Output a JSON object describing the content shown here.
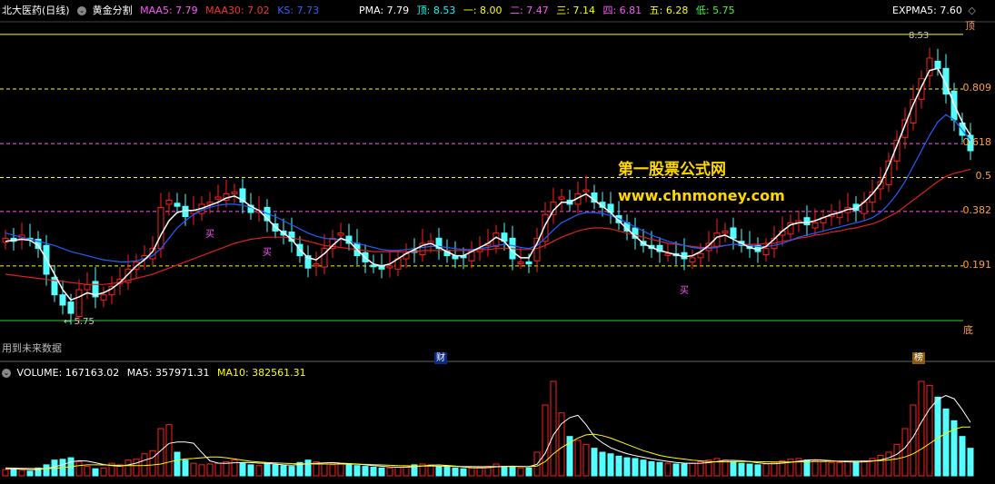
{
  "header": {
    "title": "北大医药(日线)",
    "formula": "黄金分割",
    "maa5_label": "MAA5: 7.79",
    "maa30_label": "MAA30: 7.02",
    "ks_label": "KS: 7.73",
    "pma_label": "PMA: 7.79",
    "top_label": "顶: 8.53",
    "l1_label": "一: 8.00",
    "l2_label": "二: 7.47",
    "l3_label": "三: 7.14",
    "l4_label": "四: 6.81",
    "l5_label": "五: 6.28",
    "low_label": "低: 5.75",
    "expma_label": "EXPMA5: 7.60"
  },
  "volume_header": {
    "volume_label": "VOLUME: 167163.02",
    "ma5_label": "MA5: 357971.31",
    "ma10_label": "MA10: 382561.31"
  },
  "watermark": {
    "line1": "第一股票公式网",
    "line2": "www.chnmoney.com"
  },
  "notes": {
    "future_data": "用到未来数据",
    "top_tag": "顶",
    "bottom_tag": "底",
    "finance_tag": "财",
    "rank_tag": "榜"
  },
  "chart_data": [
    {
      "type": "candlestick",
      "title": "北大医药(日线)",
      "ylim": [
        5.6,
        8.6
      ],
      "high_marker": "8.53",
      "low_marker": "5.75",
      "levels": [
        {
          "price": 8.53,
          "label": "顶",
          "color": "#ffff00"
        },
        {
          "price": 8.0,
          "label": "0.809",
          "color": "#ffff00"
        },
        {
          "price": 7.47,
          "label": "0.618",
          "color": "#ff55ff"
        },
        {
          "price": 7.14,
          "label": "0.5",
          "color": "#ffff00"
        },
        {
          "price": 6.81,
          "label": "0.382",
          "color": "#ff55ff"
        },
        {
          "price": 6.28,
          "label": "0.191",
          "color": "#ffff00"
        },
        {
          "price": 5.75,
          "label": "底",
          "color": "#33cc33"
        }
      ],
      "buy_signals": [
        {
          "index": 25,
          "label": "买"
        },
        {
          "index": 32,
          "label": "买"
        },
        {
          "index": 83,
          "label": "买"
        }
      ],
      "colors": {
        "up": "#ff2020",
        "down": "#54ffff",
        "ma_white": "#ffffff",
        "ma_blue": "#2060ff",
        "ma_red": "#e02020"
      },
      "close": [
        6.55,
        6.52,
        6.58,
        6.54,
        6.45,
        6.2,
        6.0,
        5.9,
        5.82,
        6.05,
        6.1,
        5.98,
        6.0,
        6.08,
        6.15,
        6.25,
        6.32,
        6.38,
        6.45,
        6.85,
        6.92,
        6.86,
        6.76,
        6.82,
        6.88,
        6.9,
        6.95,
        6.98,
        7.0,
        6.9,
        6.8,
        6.82,
        6.72,
        6.62,
        6.58,
        6.52,
        6.38,
        6.26,
        6.3,
        6.45,
        6.55,
        6.6,
        6.5,
        6.38,
        6.32,
        6.28,
        6.25,
        6.28,
        6.35,
        6.4,
        6.42,
        6.5,
        6.52,
        6.45,
        6.38,
        6.35,
        6.36,
        6.42,
        6.45,
        6.5,
        6.6,
        6.52,
        6.35,
        6.32,
        6.3,
        6.55,
        6.78,
        6.9,
        6.95,
        6.88,
        6.98,
        7.02,
        6.9,
        6.85,
        6.8,
        6.7,
        6.62,
        6.55,
        6.48,
        6.45,
        6.42,
        6.4,
        6.38,
        6.35,
        6.36,
        6.4,
        6.5,
        6.6,
        6.62,
        6.55,
        6.48,
        6.45,
        6.42,
        6.45,
        6.55,
        6.62,
        6.7,
        6.72,
        6.68,
        6.7,
        6.75,
        6.78,
        6.8,
        6.85,
        6.82,
        6.9,
        7.0,
        7.1,
        7.3,
        7.5,
        7.7,
        7.9,
        8.1,
        8.3,
        8.2,
        7.95,
        7.7,
        7.55,
        7.4
      ],
      "ma_white": [
        6.52,
        6.53,
        6.54,
        6.53,
        6.48,
        6.35,
        6.2,
        6.05,
        5.95,
        5.98,
        6.02,
        6.0,
        6.02,
        6.06,
        6.12,
        6.2,
        6.28,
        6.34,
        6.42,
        6.58,
        6.72,
        6.8,
        6.82,
        6.82,
        6.84,
        6.87,
        6.9,
        6.94,
        6.96,
        6.92,
        6.86,
        6.82,
        6.74,
        6.66,
        6.6,
        6.54,
        6.44,
        6.36,
        6.34,
        6.4,
        6.48,
        6.55,
        6.52,
        6.44,
        6.36,
        6.3,
        6.28,
        6.3,
        6.35,
        6.4,
        6.44,
        6.48,
        6.5,
        6.46,
        6.42,
        6.38,
        6.38,
        6.42,
        6.46,
        6.5,
        6.56,
        6.52,
        6.42,
        6.36,
        6.36,
        6.5,
        6.68,
        6.82,
        6.9,
        6.9,
        6.94,
        6.98,
        6.92,
        6.86,
        6.8,
        6.72,
        6.64,
        6.57,
        6.5,
        6.46,
        6.43,
        6.41,
        6.39,
        6.37,
        6.38,
        6.42,
        6.48,
        6.56,
        6.58,
        6.54,
        6.5,
        6.46,
        6.44,
        6.47,
        6.54,
        6.62,
        6.68,
        6.7,
        6.7,
        6.72,
        6.75,
        6.78,
        6.8,
        6.83,
        6.84,
        6.9,
        6.98,
        7.08,
        7.25,
        7.45,
        7.65,
        7.85,
        8.02,
        8.18,
        8.2,
        8.05,
        7.85,
        7.68,
        7.55
      ],
      "ma_blue": [
        6.6,
        6.58,
        6.56,
        6.54,
        6.52,
        6.5,
        6.48,
        6.45,
        6.42,
        6.4,
        6.38,
        6.36,
        6.34,
        6.33,
        6.32,
        6.32,
        6.33,
        6.35,
        6.38,
        6.45,
        6.55,
        6.65,
        6.72,
        6.78,
        6.82,
        6.85,
        6.87,
        6.88,
        6.88,
        6.87,
        6.85,
        6.82,
        6.79,
        6.76,
        6.72,
        6.68,
        6.64,
        6.6,
        6.57,
        6.55,
        6.54,
        6.54,
        6.52,
        6.5,
        6.48,
        6.46,
        6.44,
        6.43,
        6.43,
        6.44,
        6.45,
        6.46,
        6.47,
        6.47,
        6.46,
        6.45,
        6.44,
        6.44,
        6.45,
        6.46,
        6.48,
        6.49,
        6.48,
        6.46,
        6.45,
        6.48,
        6.55,
        6.63,
        6.7,
        6.74,
        6.78,
        6.8,
        6.8,
        6.79,
        6.77,
        6.74,
        6.7,
        6.66,
        6.62,
        6.58,
        6.55,
        6.52,
        6.5,
        6.48,
        6.46,
        6.45,
        6.45,
        6.46,
        6.48,
        6.49,
        6.49,
        6.48,
        6.47,
        6.47,
        6.48,
        6.5,
        6.53,
        6.56,
        6.58,
        6.6,
        6.62,
        6.64,
        6.66,
        6.68,
        6.7,
        6.72,
        6.75,
        6.8,
        6.88,
        6.98,
        7.1,
        7.25,
        7.4,
        7.55,
        7.68,
        7.75,
        7.7,
        7.6,
        7.5
      ],
      "ma_red": [
        6.2,
        6.19,
        6.18,
        6.17,
        6.16,
        6.15,
        6.14,
        6.13,
        6.12,
        6.11,
        6.1,
        6.1,
        6.1,
        6.11,
        6.12,
        6.14,
        6.16,
        6.18,
        6.2,
        6.23,
        6.26,
        6.29,
        6.32,
        6.35,
        6.38,
        6.41,
        6.44,
        6.47,
        6.5,
        6.52,
        6.54,
        6.55,
        6.56,
        6.56,
        6.56,
        6.55,
        6.54,
        6.52,
        6.5,
        6.48,
        6.47,
        6.46,
        6.45,
        6.44,
        6.43,
        6.42,
        6.42,
        6.42,
        6.42,
        6.42,
        6.42,
        6.43,
        6.43,
        6.43,
        6.43,
        6.43,
        6.43,
        6.43,
        6.44,
        6.44,
        6.45,
        6.45,
        6.45,
        6.44,
        6.44,
        6.45,
        6.48,
        6.52,
        6.56,
        6.59,
        6.62,
        6.64,
        6.65,
        6.65,
        6.64,
        6.62,
        6.6,
        6.58,
        6.56,
        6.54,
        6.52,
        6.5,
        6.49,
        6.48,
        6.47,
        6.46,
        6.46,
        6.47,
        6.48,
        6.49,
        6.49,
        6.49,
        6.49,
        6.5,
        6.5,
        6.52,
        6.53,
        6.55,
        6.56,
        6.58,
        6.59,
        6.61,
        6.62,
        6.64,
        6.65,
        6.67,
        6.69,
        6.72,
        6.76,
        6.8,
        6.86,
        6.92,
        6.98,
        7.04,
        7.1,
        7.15,
        7.18,
        7.2,
        7.22
      ]
    },
    {
      "type": "bar",
      "title": "VOLUME",
      "ylim": [
        0,
        1200000
      ],
      "volume": [
        80000,
        90000,
        70000,
        60000,
        100000,
        140000,
        200000,
        210000,
        230000,
        180000,
        120000,
        90000,
        100000,
        160000,
        140000,
        200000,
        210000,
        280000,
        320000,
        600000,
        650000,
        300000,
        200000,
        160000,
        140000,
        150000,
        160000,
        180000,
        200000,
        160000,
        140000,
        130000,
        160000,
        140000,
        130000,
        120000,
        170000,
        200000,
        180000,
        150000,
        140000,
        160000,
        150000,
        130000,
        120000,
        110000,
        100000,
        100000,
        110000,
        130000,
        140000,
        150000,
        140000,
        120000,
        110000,
        100000,
        90000,
        100000,
        110000,
        120000,
        150000,
        120000,
        110000,
        100000,
        100000,
        300000,
        900000,
        1200000,
        800000,
        500000,
        450000,
        400000,
        350000,
        300000,
        280000,
        250000,
        230000,
        220000,
        200000,
        180000,
        170000,
        160000,
        150000,
        150000,
        160000,
        180000,
        200000,
        220000,
        200000,
        180000,
        160000,
        150000,
        140000,
        150000,
        170000,
        190000,
        210000,
        220000,
        200000,
        190000,
        180000,
        170000,
        170000,
        180000,
        170000,
        190000,
        220000,
        260000,
        300000,
        400000,
        600000,
        900000,
        1200000,
        1150000,
        1000000,
        850000,
        700000,
        500000,
        350000
      ],
      "ma5": [
        90000,
        88000,
        85000,
        80000,
        80000,
        92000,
        114000,
        142000,
        176000,
        192000,
        188000,
        166000,
        144000,
        130000,
        122000,
        138000,
        162000,
        198000,
        230000,
        322000,
        412000,
        430000,
        430000,
        414000,
        298000,
        190000,
        162000,
        158000,
        166000,
        170000,
        168000,
        162000,
        158000,
        150000,
        140000,
        136000,
        144000,
        154000,
        160000,
        164000,
        168000,
        160000,
        156000,
        150000,
        140000,
        130000,
        122000,
        114000,
        108000,
        110000,
        116000,
        126000,
        134000,
        138000,
        132000,
        124000,
        112000,
        104000,
        102000,
        104000,
        114000,
        120000,
        122000,
        120000,
        116000,
        146000,
        286000,
        520000,
        662000,
        740000,
        770000,
        650000,
        500000,
        420000,
        356000,
        316000,
        282000,
        256000,
        236000,
        216000,
        200000,
        184000,
        170000,
        162000,
        158000,
        160000,
        168000,
        182000,
        196000,
        196000,
        192000,
        182000,
        166000,
        156000,
        154000,
        162000,
        172000,
        186000,
        198000,
        204000,
        200000,
        192000,
        182000,
        178000,
        176000,
        178000,
        186000,
        202000,
        228000,
        274000,
        356000,
        494000,
        682000,
        850000,
        970000,
        1020000,
        980000,
        840000,
        680000
      ],
      "ma10": [
        100000,
        98000,
        96000,
        94000,
        92000,
        92000,
        96000,
        104000,
        116000,
        130000,
        140000,
        140000,
        138000,
        136000,
        132000,
        130000,
        130000,
        132000,
        138000,
        150000,
        175000,
        200000,
        215000,
        220000,
        230000,
        240000,
        240000,
        230000,
        215000,
        200000,
        185000,
        175000,
        168000,
        164000,
        160000,
        156000,
        154000,
        152000,
        150000,
        150000,
        150000,
        150000,
        150000,
        148000,
        145000,
        142000,
        138000,
        134000,
        130000,
        127000,
        125000,
        124000,
        123000,
        122000,
        121000,
        120000,
        119000,
        118000,
        117000,
        117000,
        118000,
        119000,
        119000,
        118000,
        117000,
        125000,
        180000,
        280000,
        360000,
        420000,
        480000,
        520000,
        530000,
        510000,
        480000,
        440000,
        400000,
        360000,
        320000,
        290000,
        260000,
        240000,
        225000,
        212000,
        200000,
        190000,
        182000,
        178000,
        178000,
        180000,
        182000,
        182000,
        180000,
        178000,
        176000,
        176000,
        176000,
        178000,
        180000,
        182000,
        184000,
        186000,
        188000,
        188000,
        188000,
        188000,
        190000,
        194000,
        202000,
        216000,
        240000,
        280000,
        340000,
        410000,
        480000,
        540000,
        590000,
        620000,
        620000
      ]
    }
  ]
}
